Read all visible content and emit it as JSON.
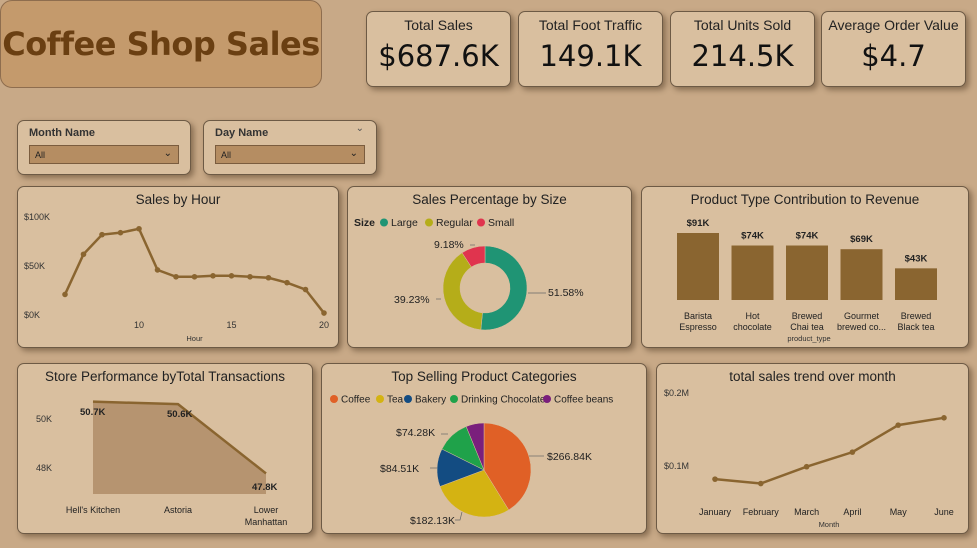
{
  "header": {
    "title": "Coffee Shop Sales"
  },
  "kpis": [
    {
      "label": "Total Sales",
      "value": "$687.6K"
    },
    {
      "label": "Total Foot Traffic",
      "value": "149.1K"
    },
    {
      "label": "Total Units Sold",
      "value": "214.5K"
    },
    {
      "label": "Average Order Value",
      "value": "$4.7"
    }
  ],
  "filters": {
    "month": {
      "label": "Month Name",
      "value": "All"
    },
    "day": {
      "label": "Day Name",
      "value": "All"
    }
  },
  "colors": {
    "brown": "#8a6530",
    "teal": "#1f9474",
    "olive": "#b5ad19",
    "red": "#e0344e",
    "coffee": "#e06026",
    "tea": "#d4b312",
    "bakery": "#134c82",
    "chocolate": "#1fa24a",
    "beans": "#7a1f7c"
  },
  "chart_data": [
    {
      "id": "sales_by_hour",
      "type": "line",
      "title": "Sales by Hour",
      "xlabel": "Hour",
      "ylabel": "",
      "x": [
        6,
        7,
        8,
        9,
        10,
        11,
        12,
        13,
        14,
        15,
        16,
        17,
        18,
        19,
        20
      ],
      "values": [
        21,
        62,
        82,
        84,
        88,
        46,
        39,
        39,
        40,
        40,
        39,
        38,
        33,
        26,
        2
      ],
      "ylim": [
        0,
        100
      ],
      "xticks": [
        "10",
        "15",
        "20"
      ],
      "yticks": [
        "$0K",
        "$50K",
        "$100K"
      ]
    },
    {
      "id": "sales_by_size",
      "type": "pie",
      "title": "Sales Percentage by Size",
      "legend_title": "Size",
      "categories": [
        "Large",
        "Regular",
        "Small"
      ],
      "values": [
        51.58,
        39.23,
        9.18
      ],
      "labels": [
        "51.58%",
        "39.23%",
        "9.18%"
      ]
    },
    {
      "id": "product_type_revenue",
      "type": "bar",
      "title": "Product Type Contribution to Revenue",
      "xlabel": "product_type",
      "categories": [
        [
          "Barista",
          "Espresso"
        ],
        [
          "Hot",
          "chocolate"
        ],
        [
          "Brewed",
          "Chai tea"
        ],
        [
          "Gourmet",
          "brewed co..."
        ],
        [
          "Brewed",
          "Black tea"
        ]
      ],
      "values": [
        91,
        74,
        74,
        69,
        43
      ],
      "labels": [
        "$91K",
        "$74K",
        "$74K",
        "$69K",
        "$43K"
      ]
    },
    {
      "id": "store_performance",
      "type": "area",
      "title": "Store Performance byTotal Transactions",
      "categories": [
        [
          "Hell's Kitchen"
        ],
        [
          "Astoria"
        ],
        [
          "Lower",
          "Manhattan"
        ]
      ],
      "values": [
        50.7,
        50.6,
        47.8
      ],
      "labels": [
        "50.7K",
        "50.6K",
        "47.8K"
      ],
      "yticks": [
        "50K",
        "48K"
      ]
    },
    {
      "id": "top_categories",
      "type": "pie",
      "title": "Top Selling Product Categories",
      "categories": [
        "Coffee",
        "Tea",
        "Bakery",
        "Drinking Chocolate",
        "Coffee beans"
      ],
      "values": [
        266.84,
        182.13,
        84.51,
        74.28,
        40.09
      ],
      "labels": [
        "$266.84K",
        "$182.13K",
        "$84.51K",
        "$74.28K",
        ""
      ]
    },
    {
      "id": "monthly_trend",
      "type": "line",
      "title": "total sales trend over month",
      "xlabel": "Month",
      "categories": [
        "January",
        "February",
        "March",
        "April",
        "May",
        "June"
      ],
      "values": [
        0.082,
        0.076,
        0.099,
        0.119,
        0.156,
        0.166
      ],
      "ylim": [
        0,
        0.2
      ],
      "yticks": [
        "$0.1M",
        "$0.2M"
      ]
    }
  ]
}
